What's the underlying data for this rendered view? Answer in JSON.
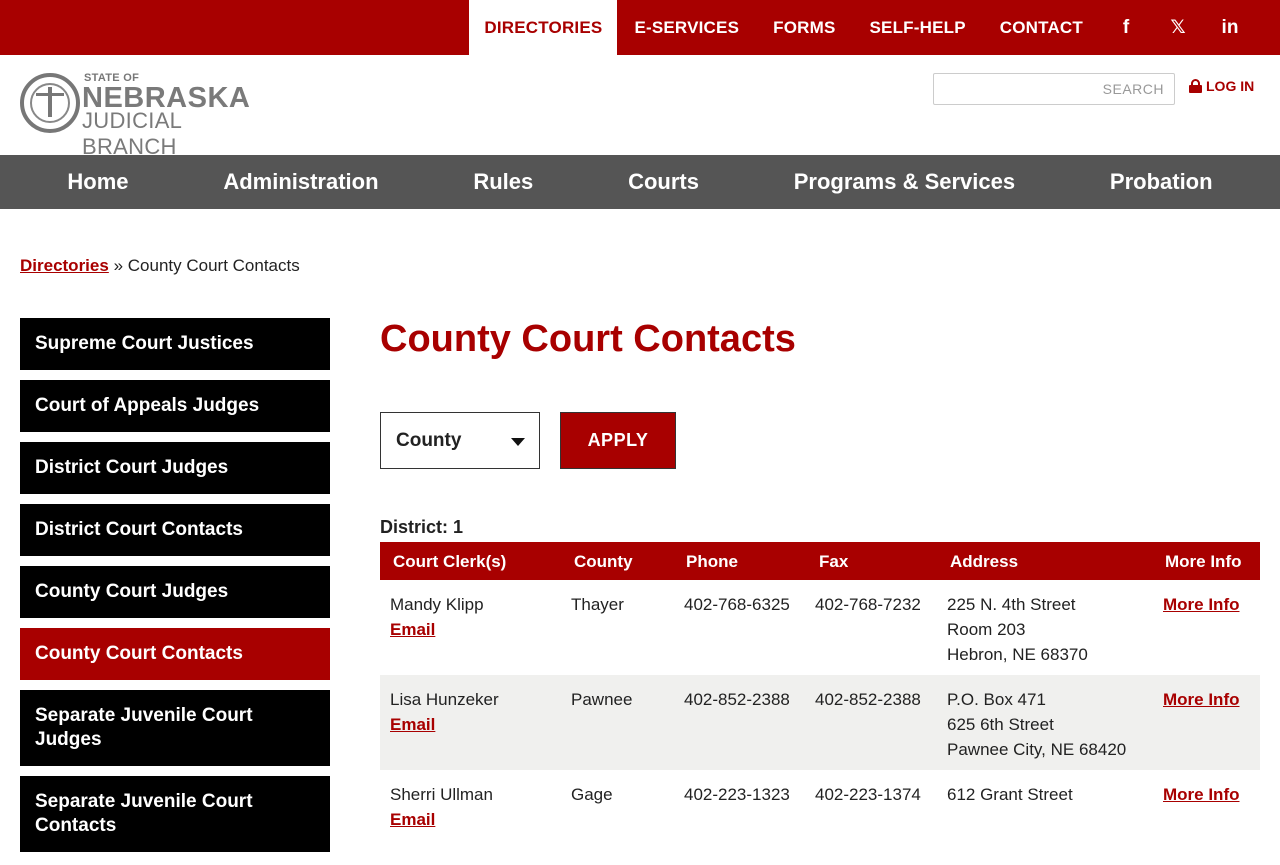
{
  "topnav": {
    "items": [
      "DIRECTORIES",
      "E-SERVICES",
      "FORMS",
      "SELF-HELP",
      "CONTACT"
    ],
    "social": [
      "f",
      "𝕏",
      "in"
    ]
  },
  "header": {
    "logo": {
      "state": "STATE OF",
      "name": "NEBRASKA",
      "branch": "JUDICIAL BRANCH"
    },
    "search_placeholder": "SEARCH",
    "login": "LOG IN"
  },
  "mainnav": [
    "Home",
    "Administration",
    "Rules",
    "Courts",
    "Programs & Services",
    "Probation"
  ],
  "breadcrumb": {
    "link": "Directories",
    "separator": "»",
    "current": "County Court Contacts"
  },
  "sidebar": [
    "Supreme Court Justices",
    "Court of Appeals Judges",
    "District Court Judges",
    "District Court Contacts",
    "County Court Judges",
    "County Court Contacts",
    "Separate Juvenile Court Judges",
    "Separate Juvenile Court Contacts"
  ],
  "page": {
    "title": "County Court Contacts",
    "filter_value": "County",
    "apply_label": "APPLY",
    "district_label": "District: 1"
  },
  "table": {
    "headers": [
      "Court Clerk(s)",
      "County",
      "Phone",
      "Fax",
      "Address",
      "More Info"
    ],
    "rows": [
      {
        "clerk": "Mandy Klipp",
        "email": "Email",
        "county": "Thayer",
        "phone": "402-768-6325",
        "fax": "402-768-7232",
        "address": [
          "225 N. 4th Street",
          "Room 203",
          "Hebron, NE 68370"
        ],
        "more": "More Info"
      },
      {
        "clerk": "Lisa Hunzeker",
        "email": "Email",
        "county": "Pawnee",
        "phone": "402-852-2388",
        "fax": "402-852-2388",
        "address": [
          "P.O. Box 471",
          "625 6th Street",
          "Pawnee City, NE 68420"
        ],
        "more": "More Info"
      },
      {
        "clerk": "Sherri Ullman",
        "email": "Email",
        "county": "Gage",
        "phone": "402-223-1323",
        "fax": "402-223-1374",
        "address": [
          "612 Grant Street"
        ],
        "more": "More Info"
      }
    ]
  },
  "colors": {
    "brand_red": "#a80000",
    "nav_gray": "#555555",
    "sidebar_black": "#000000",
    "row_alt": "#f0f0ee"
  }
}
